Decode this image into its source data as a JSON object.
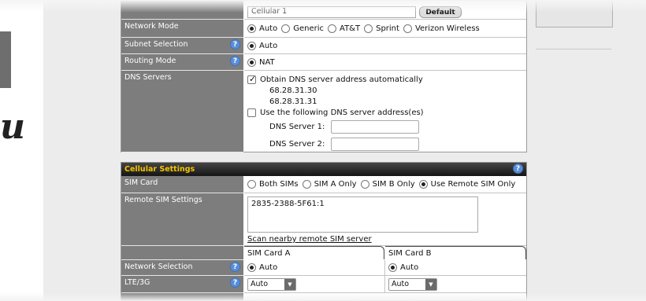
{
  "top_field": {
    "value": "Cellular 1",
    "default_button": "Default"
  },
  "wan_settings": {
    "network_mode": {
      "label": "Network Mode",
      "options": [
        "Auto",
        "Generic",
        "AT&T",
        "Sprint",
        "Verizon Wireless"
      ],
      "selected": "Auto"
    },
    "subnet_selection": {
      "label": "Subnet Selection",
      "value": "Auto"
    },
    "routing_mode": {
      "label": "Routing Mode",
      "value": "NAT"
    },
    "dns_servers": {
      "label": "DNS Servers",
      "auto_label": "Obtain DNS server address automatically",
      "auto_checked": true,
      "auto_addresses": [
        "68.28.31.30",
        "68.28.31.31"
      ],
      "manual_label": "Use the following DNS server address(es)",
      "manual_checked": false,
      "server1_label": "DNS Server 1:",
      "server2_label": "DNS Server 2:",
      "server1_value": "",
      "server2_value": ""
    }
  },
  "cellular_settings": {
    "title": "Cellular Settings",
    "sim_card": {
      "label": "SIM Card",
      "options": [
        "Both SIMs",
        "SIM A Only",
        "SIM B Only",
        "Use Remote SIM Only"
      ],
      "selected": "Use Remote SIM Only"
    },
    "remote_sim": {
      "label": "Remote SIM Settings",
      "value": "2835-2388-5F61:1",
      "scan_link": "Scan nearby remote SIM server"
    },
    "columns": [
      "SIM Card A",
      "SIM Card B"
    ],
    "network_selection": {
      "label": "Network Selection",
      "sim_a": "Auto",
      "sim_b": "Auto"
    },
    "lte_3g": {
      "label": "LTE/3G",
      "sim_a": "Auto",
      "sim_b": "Auto"
    }
  },
  "icons": {
    "help": "?"
  },
  "colors": {
    "label_bg": "#7d7d7d",
    "header_text": "#f5c400",
    "help_icon": "#5a8fd8"
  }
}
